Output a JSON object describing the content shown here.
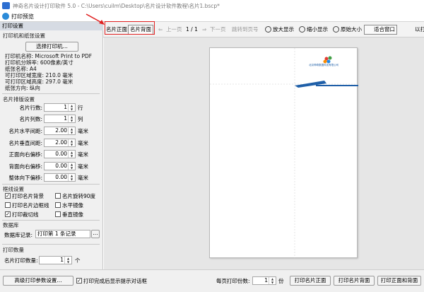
{
  "window": {
    "title": "神奇名片设计打印软件 5.0 - C:\\Users\\cuilm\\Desktop\\名片设计软件教程\\名片1.bscp*"
  },
  "dialog": {
    "title": "打印预览"
  },
  "panel": {
    "header": "打印设置",
    "printer_section": {
      "title": "打印机和纸张设置",
      "select_button": "选择打印机...",
      "info": [
        "打印机名称: Microsoft Print to PDF",
        "打印机分辨率: 600像素/英寸",
        "纸张名称: A4",
        "可打印区域宽度: 210.0 毫米",
        "可打印区域高度: 297.0 毫米",
        "纸张方向: 纵向"
      ]
    },
    "layout_section": {
      "title": "名片排版设置",
      "fields": [
        {
          "label": "名片行数:",
          "value": "1",
          "unit": "行"
        },
        {
          "label": "名片列数:",
          "value": "1",
          "unit": "列"
        },
        {
          "label": "名片水平间距:",
          "value": "2.00",
          "unit": "毫米"
        },
        {
          "label": "名片垂直间距:",
          "value": "2.00",
          "unit": "毫米"
        },
        {
          "label": "正面向右偏移:",
          "value": "0.00",
          "unit": "毫米"
        },
        {
          "label": "背面向右偏移:",
          "value": "0.00",
          "unit": "毫米"
        },
        {
          "label": "整体向下偏移:",
          "value": "0.00",
          "unit": "毫米"
        }
      ]
    },
    "crop_section": {
      "title": "框线设置",
      "options": [
        {
          "label": "打印名片背景",
          "checked": true
        },
        {
          "label": "名片旋转90度",
          "checked": false
        },
        {
          "label": "打印名片边框线",
          "checked": false
        },
        {
          "label": "水平镜像",
          "checked": false
        },
        {
          "label": "打印裁切线",
          "checked": true
        },
        {
          "label": "垂直镜像",
          "checked": false
        }
      ]
    },
    "database_section": {
      "title": "数据库",
      "label": "数据库记录:",
      "value": "打印第 1 条记录",
      "browse": "..."
    },
    "quantity_section": {
      "title": "打印数量",
      "label": "名片打印数量:",
      "value": "1",
      "unit": "个"
    }
  },
  "toolbar": {
    "front": "名片正面",
    "back": "名片背面",
    "prev": "上一页",
    "page_indicator": "1 / 1",
    "next": "下一页",
    "goto": "跳转到页号",
    "zoom_in": "放大显示",
    "zoom_out": "缩小显示",
    "original": "原始大小",
    "fit": "适合窗口",
    "extra": "以打"
  },
  "preview": {
    "company_name": "北京神奇数据科技有限公司",
    "accent_color": "#1f5fa8"
  },
  "bottom": {
    "advanced_button": "高级打印参数设置...",
    "show_dialog_label": "打印完成后显示提示对话框",
    "show_dialog_checked": true,
    "per_page_label": "每页打印份数:",
    "per_page_value": "1",
    "per_page_unit": "份",
    "print_front": "打印名片正面",
    "print_back": "打印名片背面",
    "print_both": "打印正面和背面"
  }
}
